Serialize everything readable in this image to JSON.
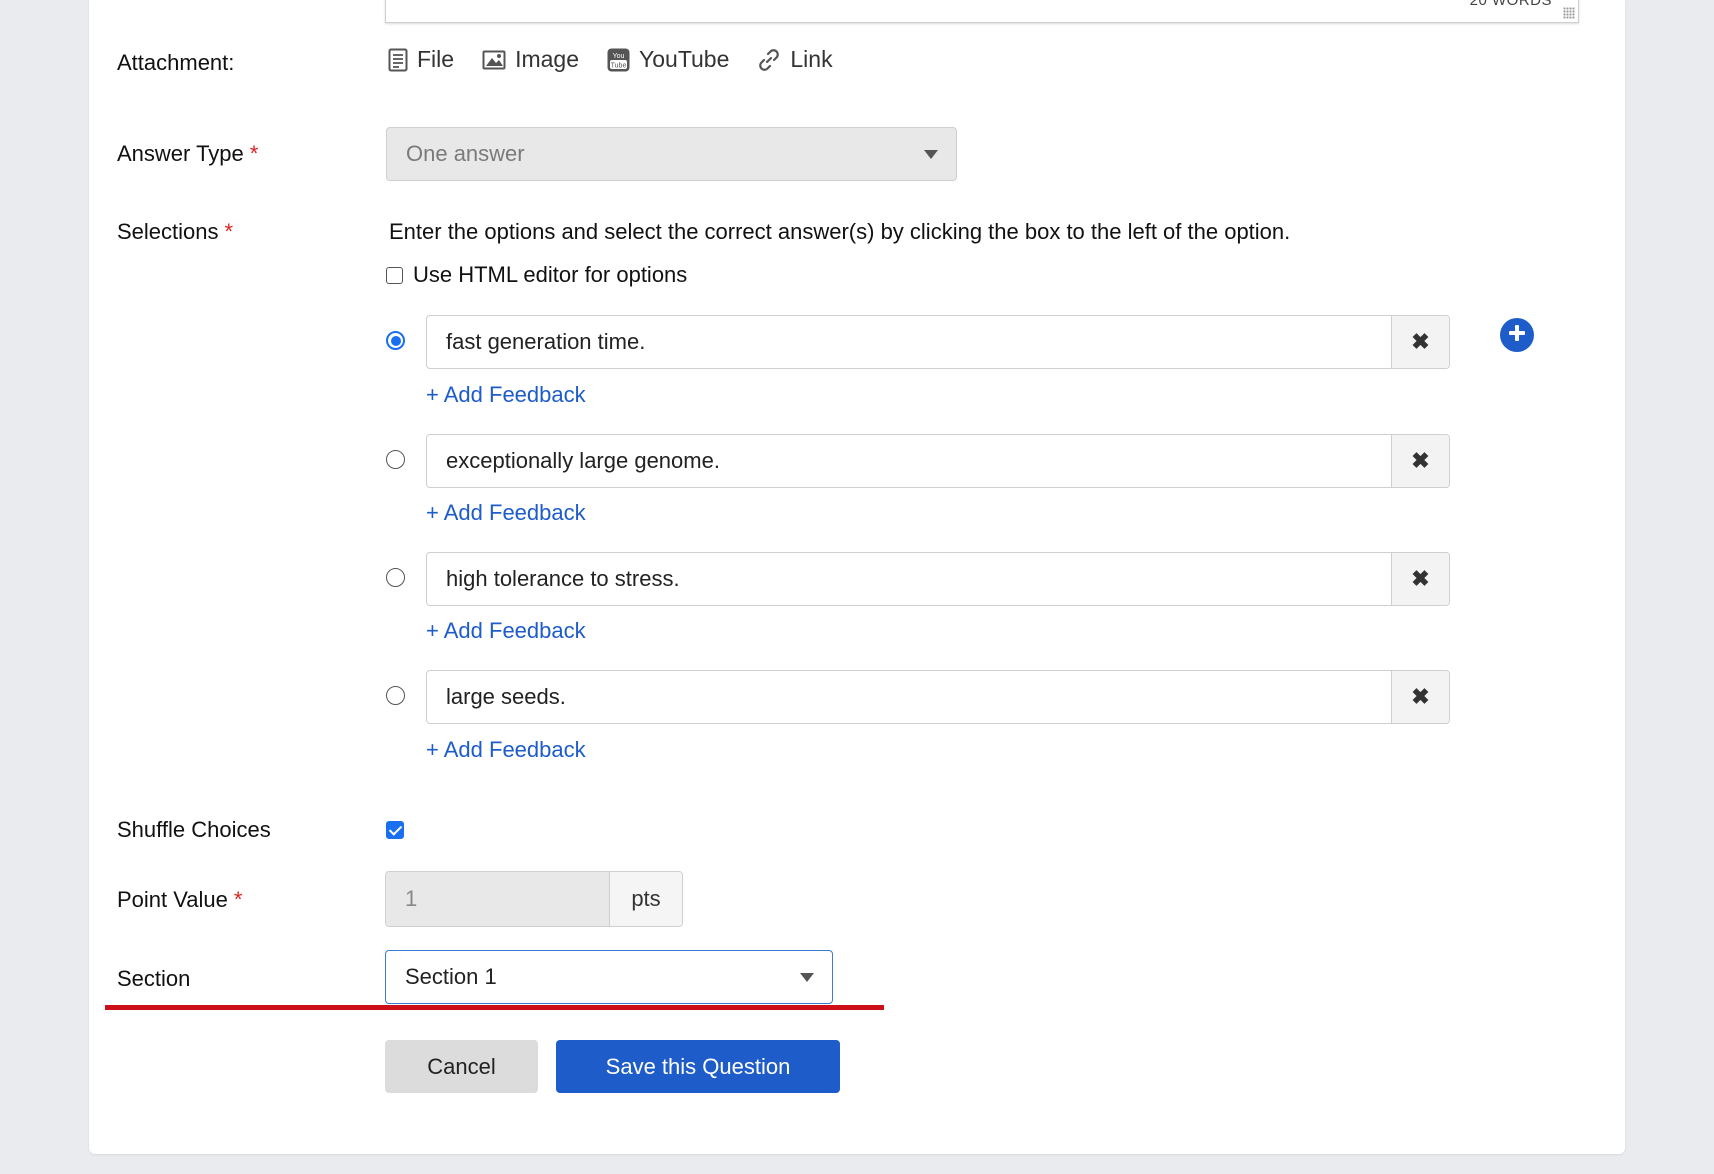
{
  "editor": {
    "word_count": "20 WORDS"
  },
  "attachment": {
    "label": "Attachment:",
    "items": [
      {
        "icon": "file-icon",
        "label": "File"
      },
      {
        "icon": "image-icon",
        "label": "Image"
      },
      {
        "icon": "youtube-icon",
        "label": "YouTube"
      },
      {
        "icon": "link-icon",
        "label": "Link"
      }
    ]
  },
  "answer_type": {
    "label": "Answer Type",
    "required": "*",
    "value": "One answer"
  },
  "selections": {
    "label": "Selections",
    "required": "*",
    "instructions": "Enter the options and select the correct answer(s) by clicking the box to the left of the option.",
    "html_editor_label": "Use HTML editor for options",
    "html_editor_checked": false,
    "add_feedback_label": "+ Add Feedback",
    "remove_glyph": "✖",
    "options": [
      {
        "text": "fast generation time.",
        "selected": true
      },
      {
        "text": "exceptionally large genome.",
        "selected": false
      },
      {
        "text": "high tolerance to stress.",
        "selected": false
      },
      {
        "text": "large seeds.",
        "selected": false
      }
    ]
  },
  "shuffle": {
    "label": "Shuffle Choices",
    "checked": true
  },
  "points": {
    "label": "Point Value",
    "required": "*",
    "value": "1",
    "unit": "pts"
  },
  "section": {
    "label": "Section",
    "value": "Section 1"
  },
  "buttons": {
    "cancel": "Cancel",
    "save": "Save this Question"
  },
  "colors": {
    "primary": "#1d5cc9",
    "required": "#d9231f",
    "annotation_underline": "#cc1019"
  }
}
